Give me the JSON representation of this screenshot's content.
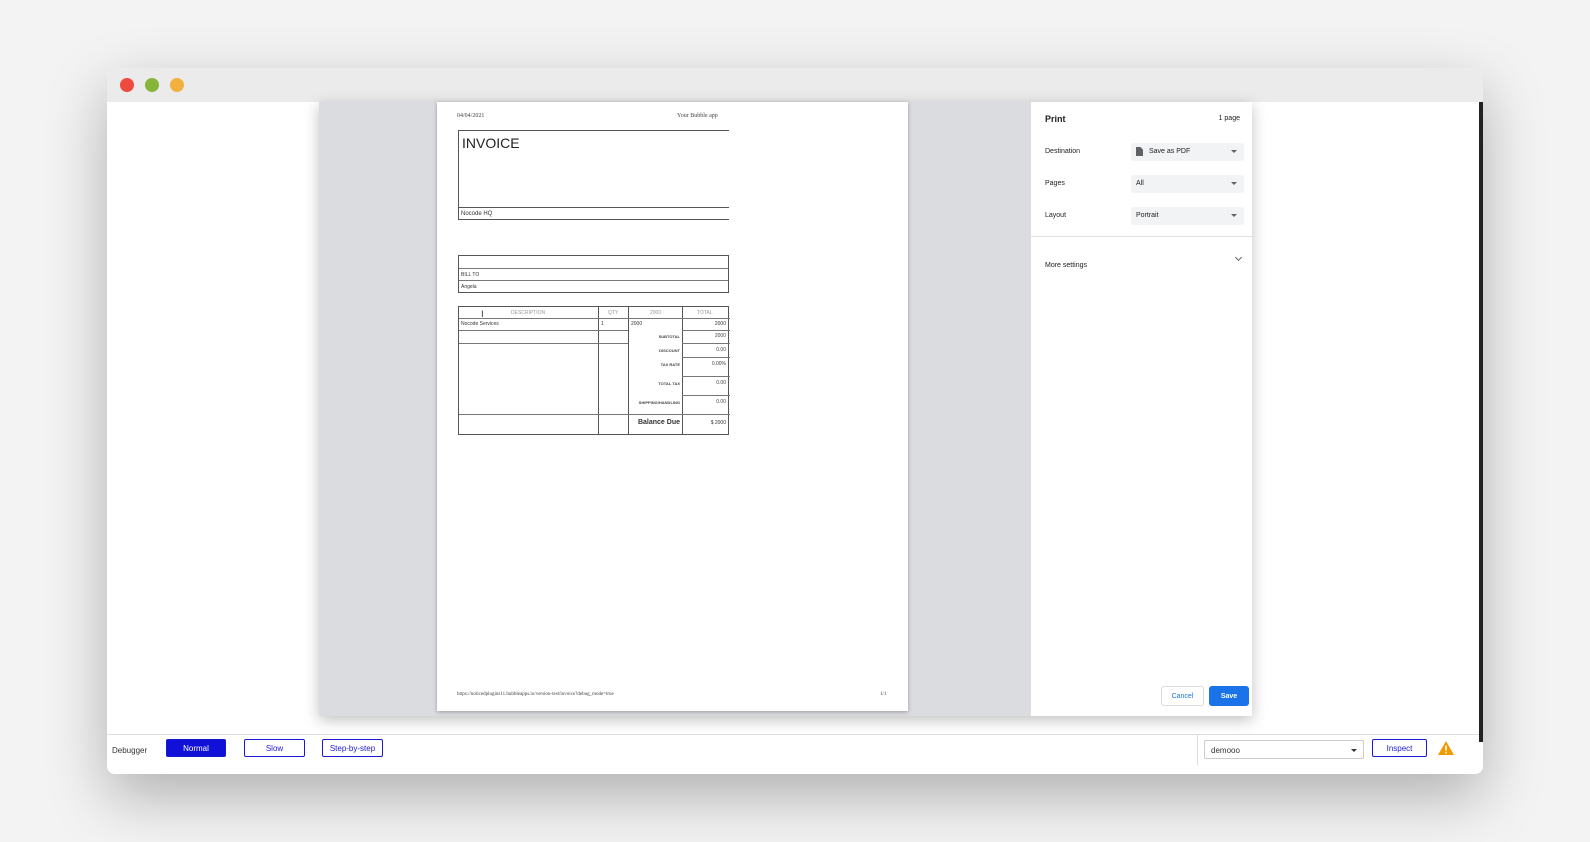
{
  "window": {
    "lights": [
      "close",
      "minimize",
      "maximize"
    ]
  },
  "invoice_page": {
    "header_date": "04/04/2021",
    "header_app": "Your Bubble app",
    "title": "INVOICE",
    "company": "Nocode HQ",
    "bill_to_label": "BILL TO",
    "bill_to_name": "Angela",
    "columns": [
      "DESCRIPTION",
      "QTY",
      "2000",
      "TOTAL"
    ],
    "line_item": {
      "description": "Nocode Services",
      "qty": "1",
      "price": "2000",
      "total": "2000"
    },
    "summary": [
      {
        "label": "SUBTOTAL",
        "value": "2000"
      },
      {
        "label": "DISCOUNT",
        "value": "0.00"
      },
      {
        "label": "TAX RATE",
        "value": "0.00%"
      },
      {
        "label": "TOTAL TAX",
        "value": "0.00"
      },
      {
        "label": "SHIPPING/HANDLING",
        "value": "0.00"
      }
    ],
    "balance_label": "Balance Due",
    "balance_value": "$ 2000",
    "footer_url": "https://noticedplugins11.bubbleapps.io/version-test/invoice?debug_mode=true",
    "footer_page": "1/1"
  },
  "print": {
    "title": "Print",
    "page_count": "1 page",
    "destination_label": "Destination",
    "destination_value": "Save as PDF",
    "pages_label": "Pages",
    "pages_value": "All",
    "layout_label": "Layout",
    "layout_value": "Portrait",
    "more_settings": "More settings",
    "cancel": "Cancel",
    "save": "Save",
    "accent_color": "#1a73e8"
  },
  "debugger": {
    "label": "Debugger",
    "modes": [
      "Normal",
      "Slow",
      "Step-by-step"
    ],
    "active_mode": "Normal",
    "select_value": "demooo",
    "inspect": "Inspect",
    "warning_icon": "warning-triangle-icon",
    "accent_color": "#1010d8"
  }
}
